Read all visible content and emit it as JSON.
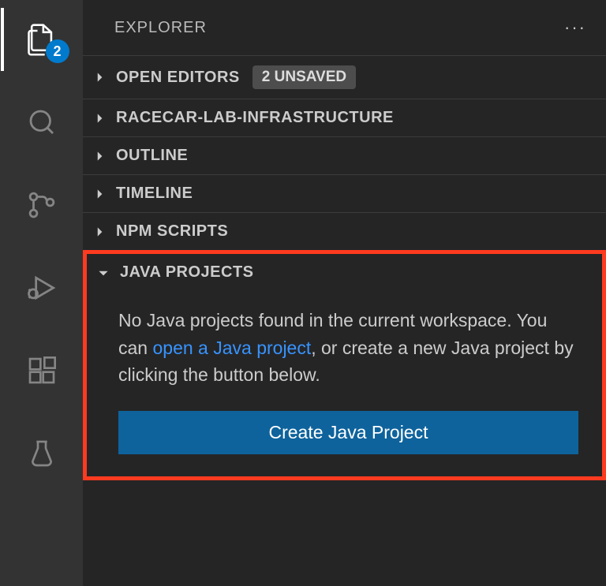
{
  "sidebar_title": "EXPLORER",
  "activity_badge": "2",
  "sections": {
    "open_editors": "OPEN EDITORS",
    "open_editors_badge": "2 UNSAVED",
    "workspace": "RACECAR-LAB-INFRASTRUCTURE",
    "outline": "OUTLINE",
    "timeline": "TIMELINE",
    "npm": "NPM SCRIPTS",
    "java": "JAVA PROJECTS"
  },
  "java_panel": {
    "msg_pre": "No Java projects found in the current workspace. You can ",
    "link": "open a Java project",
    "msg_post": ", or create a new Java project by clicking the button below.",
    "button": "Create Java Project"
  }
}
